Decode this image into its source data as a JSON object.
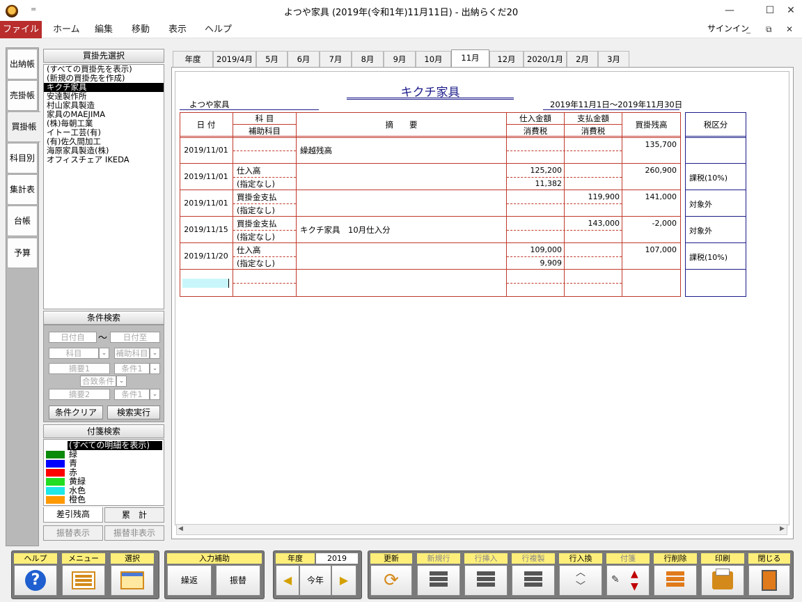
{
  "window": {
    "title": "よつや家具 (2019年(令和1年)11月11日) - 出納らくだ20",
    "qa": "=",
    "min": "—",
    "max": "☐",
    "close": "✕",
    "inner_min": "_",
    "inner_restore": "⧉",
    "inner_close": "✕"
  },
  "menu": {
    "file": "ファイル",
    "items": [
      "ホーム",
      "編集",
      "移動",
      "表示",
      "ヘルプ"
    ],
    "signin": "サインイン"
  },
  "left_tabs": [
    "出納帳",
    "売掛帳",
    "買掛帳",
    "科目別",
    "集計表",
    "台帳",
    "予算"
  ],
  "supplier_panel": {
    "header": "買掛先選択",
    "items": [
      "(すべての買掛先を表示)",
      "(新規の買掛先を作成)",
      "キクチ家具",
      "安達製作所",
      "村山家具製造",
      "家具のMAEJIMA",
      "(株)毎朝工業",
      "イトー工芸(有)",
      "(有)佐久間加工",
      "海原家具製造(株)",
      "オフィスチェア IKEDA"
    ]
  },
  "condition": {
    "header": "条件検索",
    "date_from": "日付自",
    "tilde": "〜",
    "date_to": "日付至",
    "account": "科目",
    "sub_account": "補助科目",
    "memo1": "摘要1",
    "cond1": "条件1",
    "match": "合致条件",
    "memo2": "摘要2",
    "cond2": "条件1",
    "clear_btn": "条件クリア",
    "search_btn": "検索実行",
    "dd": "⌄"
  },
  "tags": {
    "header": "付箋検索",
    "all": "(すべての明細を表示)",
    "items": [
      {
        "label": "緑",
        "color": "#0a8a0a"
      },
      {
        "label": "青",
        "color": "#0000ff"
      },
      {
        "label": "赤",
        "color": "#ff0000"
      },
      {
        "label": "黄緑",
        "color": "#22dd22"
      },
      {
        "label": "水色",
        "color": "#1ee8e8"
      },
      {
        "label": "橙色",
        "color": "#ff9900"
      }
    ]
  },
  "subtabs": {
    "diff": "差引残高",
    "cumulative": "累　計",
    "show_transfer": "振替表示",
    "hide_transfer": "振替非表示"
  },
  "month_tabs": [
    "年度",
    "2019/4月",
    "5月",
    "6月",
    "7月",
    "8月",
    "9月",
    "10月",
    "11月",
    "12月",
    "2020/1月",
    "2月",
    "3月"
  ],
  "active_month": "11月",
  "ledger": {
    "supplier_title": "キクチ家具",
    "company": "よつや家具",
    "period": "2019年11月1日～2019年11月30日",
    "headers": {
      "date": "日 付",
      "account": "科 目",
      "sub_account": "補助科目",
      "memo": "摘　　要",
      "purchase": "仕入金額",
      "tax1": "消費税",
      "payment": "支払金額",
      "tax2": "消費税",
      "balance": "買掛残高",
      "tax_class": "税区分"
    },
    "rows": [
      {
        "date": "2019/11/01",
        "account": "",
        "sub": "",
        "memo": "繰越残高",
        "purchase": "",
        "tax": "",
        "payment": "",
        "balance": "135,700",
        "tax_class": ""
      },
      {
        "date": "2019/11/01",
        "account": "仕入高",
        "sub": "(指定なし)",
        "memo": "",
        "purchase": "125,200",
        "tax": "11,382",
        "payment": "",
        "balance": "260,900",
        "tax_class": "課税(10%)"
      },
      {
        "date": "2019/11/01",
        "account": "買掛金支払",
        "sub": "(指定なし)",
        "memo": "",
        "purchase": "",
        "tax": "",
        "payment": "119,900",
        "balance": "141,000",
        "tax_class": "対象外"
      },
      {
        "date": "2019/11/15",
        "account": "買掛金支払",
        "sub": "(指定なし)",
        "memo": "キクチ家具　10月仕入分",
        "purchase": "",
        "tax": "",
        "payment": "143,000",
        "balance": "-2,000",
        "tax_class": "対象外"
      },
      {
        "date": "2019/11/20",
        "account": "仕入高",
        "sub": "(指定なし)",
        "memo": "",
        "purchase": "109,000",
        "tax": "9,909",
        "payment": "",
        "balance": "107,000",
        "tax_class": "課税(10%)"
      }
    ]
  },
  "toolbar": {
    "help": "ヘルプ",
    "menu": "メニュー",
    "select": "選択",
    "input_assist": "入力補助",
    "repeat": "繰返",
    "transfer": "振替",
    "year_label": "年度",
    "year_value": "2019",
    "this_year": "今年",
    "refresh": "更新",
    "new_row": "新規行",
    "insert_row": "行挿入",
    "copy_row": "行複製",
    "swap_row": "行入換",
    "tag": "付箋",
    "delete_row": "行削除",
    "print": "印刷",
    "close": "閉じる"
  }
}
